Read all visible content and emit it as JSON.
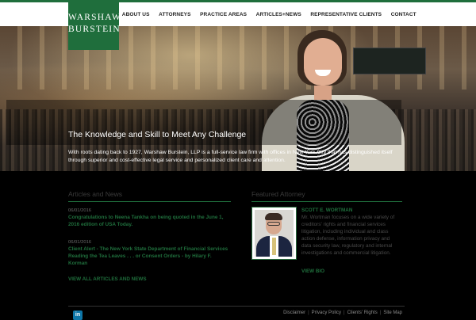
{
  "brand": {
    "line1": "WARSHAW",
    "line2": "BURSTEIN"
  },
  "nav": {
    "items": [
      "ABOUT US",
      "ATTORNEYS",
      "PRACTICE AREAS",
      "ARTICLES+NEWS",
      "REPRESENTATIVE CLIENTS",
      "CONTACT"
    ]
  },
  "hero": {
    "title": "The Knowledge and Skill to Meet Any Challenge",
    "text": "With roots dating back to 1927, Warshaw Burstein, LLP is a full-service law firm with offices in New York City that has distinguished itself through superior and cost-effective legal service and personalized client care and attention."
  },
  "news": {
    "title": "Articles and News",
    "items": [
      {
        "date": "06/01/2016",
        "text": "Congratulations to Neena Tankha on being quoted in the June 1, 2016 edition of USA Today."
      },
      {
        "date": "06/01/2016",
        "text": "Client Alert - The New York State Department of Financial Services Reading the Tea Leaves . . . or Consent Orders - by Hilary F. Korman"
      }
    ],
    "all_link": "VIEW ALL ARTICLES AND NEWS"
  },
  "featured": {
    "title": "Featured Attorney",
    "name": "SCOTT E. WORTMAN",
    "bio": "Mr. Wortman focuses on a wide variety of creditors' rights and financial services litigation, including individual and class action defense, information privacy and data security law, regulatory and internal investigations and commercial litigation.",
    "link": "VIEW BIO"
  },
  "footer": {
    "social": "in",
    "links": [
      "Disclaimer",
      "Privacy Policy",
      "Clients' Rights",
      "Site Map"
    ]
  },
  "colors": {
    "brand_green": "#1f6e3c"
  }
}
